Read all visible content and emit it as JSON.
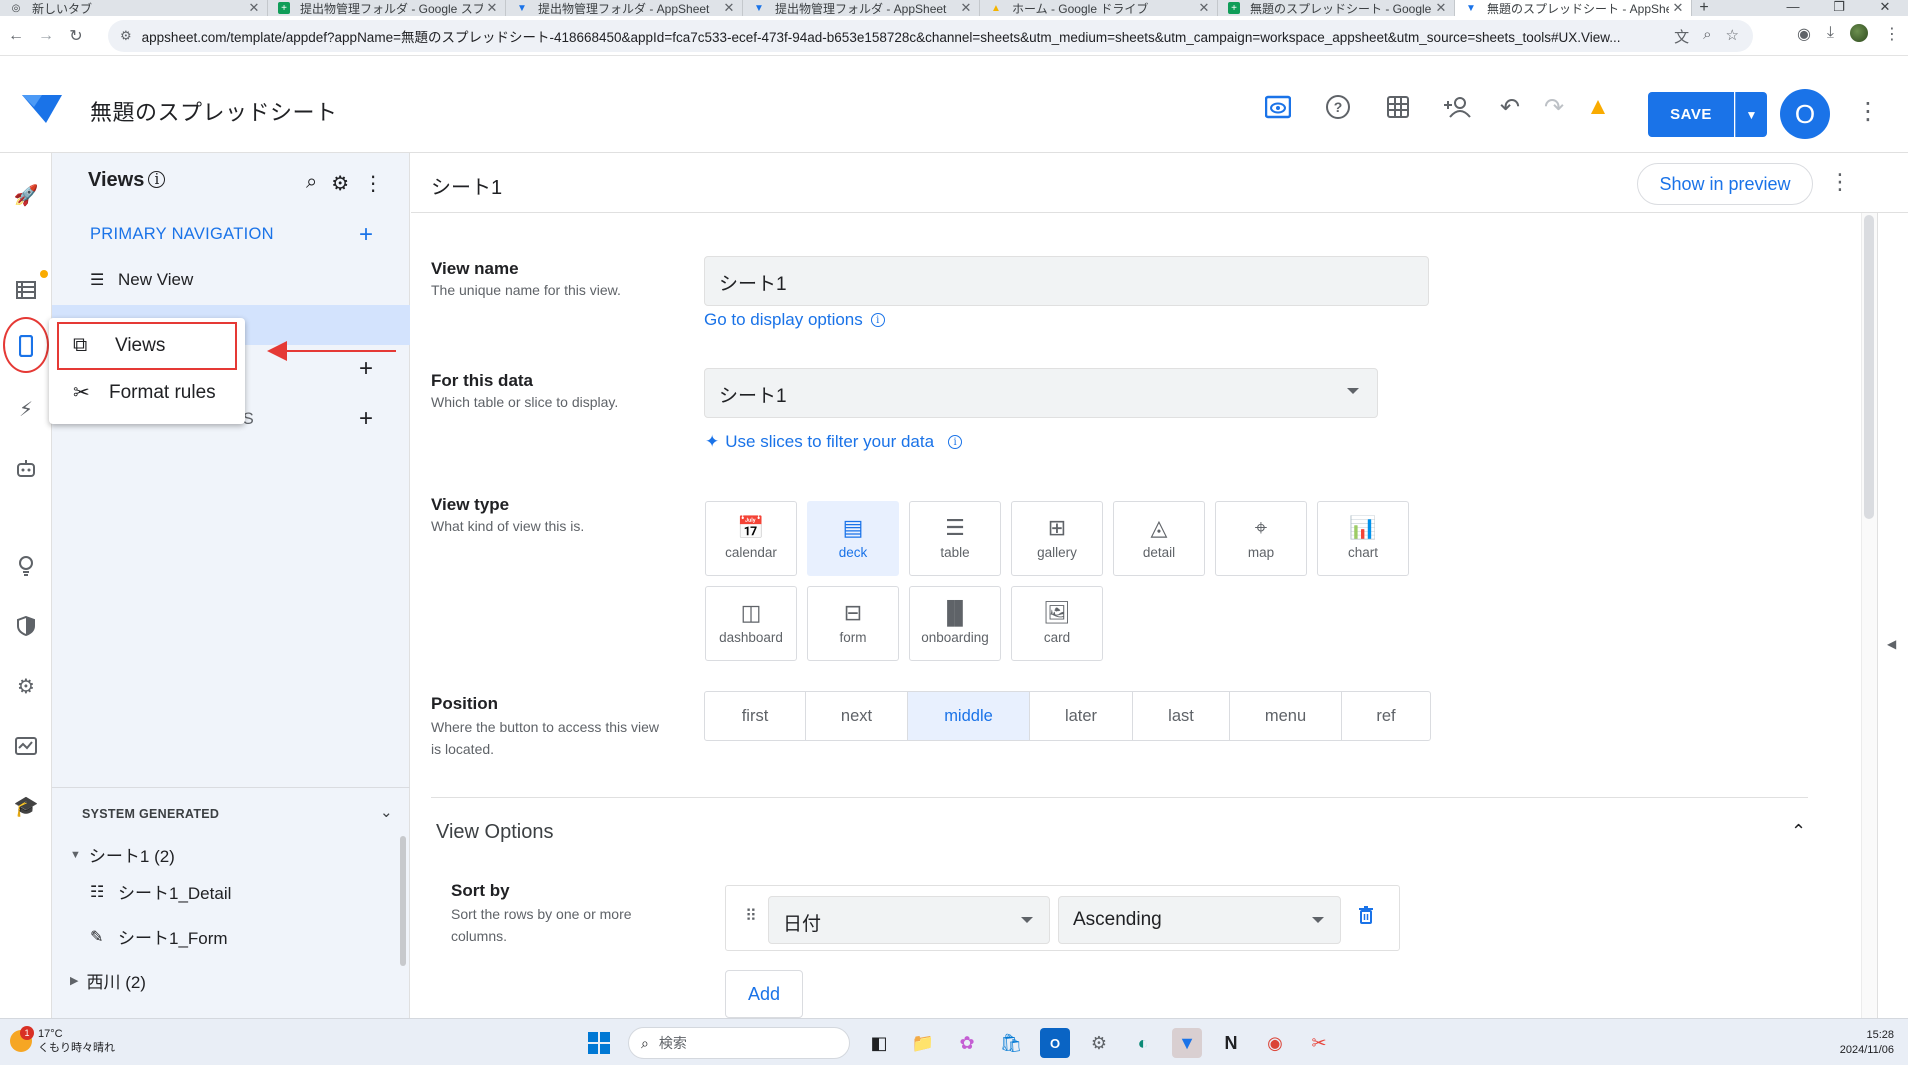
{
  "browser": {
    "tabs": [
      {
        "title": "新しいタブ",
        "icon": "chrome-icon",
        "active": false
      },
      {
        "title": "提出物管理フォルダ - Google スプ",
        "icon": "sheets-icon",
        "active": false
      },
      {
        "title": "提出物管理フォルダ - AppSheet",
        "icon": "appsheet-icon",
        "active": false
      },
      {
        "title": "提出物管理フォルダ - AppSheet",
        "icon": "appsheet-icon",
        "active": false
      },
      {
        "title": "ホーム - Google ドライブ",
        "icon": "drive-icon",
        "active": false
      },
      {
        "title": "無題のスプレッドシート - Google ス",
        "icon": "sheets-icon",
        "active": false
      },
      {
        "title": "無題のスプレッドシート - AppSheet",
        "icon": "appsheet-icon",
        "active": true
      }
    ],
    "url": "appsheet.com/template/appdef?appName=無題のスプレッドシート-418668450&appId=fca7c533-ecef-473f-94ad-b653e158728c&channel=sheets&utm_medium=sheets&utm_campaign=workspace_appsheet&utm_source=sheets_tools#UX.View..."
  },
  "app": {
    "title": "無題のスプレッドシート",
    "save_label": "SAVE",
    "avatar_letter": "O"
  },
  "views_panel": {
    "title": "Views",
    "primary_nav_label": "PRIMARY NAVIGATION",
    "new_view_label": "New View",
    "reference_views_label": "REFERENCE VIEWS",
    "system_generated_label": "SYSTEM GENERATED",
    "tree": {
      "group1": "シート1 (2)",
      "detail": "シート1_Detail",
      "form": "シート1_Form",
      "group2": "西川 (2)"
    }
  },
  "popup_menu": {
    "views_label": "Views",
    "format_rules_label": "Format rules"
  },
  "editor": {
    "title": "シート1",
    "show_in_preview": "Show in preview",
    "view_name": {
      "label": "View name",
      "desc": "The unique name for this view.",
      "value": "シート1"
    },
    "display_options_link": "Go to display options",
    "for_this_data": {
      "label": "For this data",
      "desc": "Which table or slice to display.",
      "value": "シート1"
    },
    "slices_link": "Use slices to filter your data",
    "view_type": {
      "label": "View type",
      "desc": "What kind of view this is.",
      "selected": "deck",
      "options": [
        "calendar",
        "deck",
        "table",
        "gallery",
        "detail",
        "map",
        "chart",
        "dashboard",
        "form",
        "onboarding",
        "card"
      ]
    },
    "position": {
      "label": "Position",
      "desc": "Where the button to access this view is located.",
      "selected": "middle",
      "options": [
        "first",
        "next",
        "middle",
        "later",
        "last",
        "menu",
        "ref"
      ]
    },
    "view_options_title": "View Options",
    "sort_by": {
      "label": "Sort by",
      "desc": "Sort the rows by one or more columns.",
      "column": "日付",
      "direction": "Ascending",
      "add_label": "Add"
    }
  },
  "taskbar": {
    "temperature": "17°C",
    "weather_text": "くもり時々晴れ",
    "notification_count": "1",
    "search_placeholder": "検索",
    "time": "15:28",
    "date": "2024/11/06"
  },
  "colors": {
    "accent": "#1a73e8",
    "highlight_red": "#e53935",
    "panel_bg": "#f0f4fa",
    "selected_bg": "#e8f0fe"
  }
}
